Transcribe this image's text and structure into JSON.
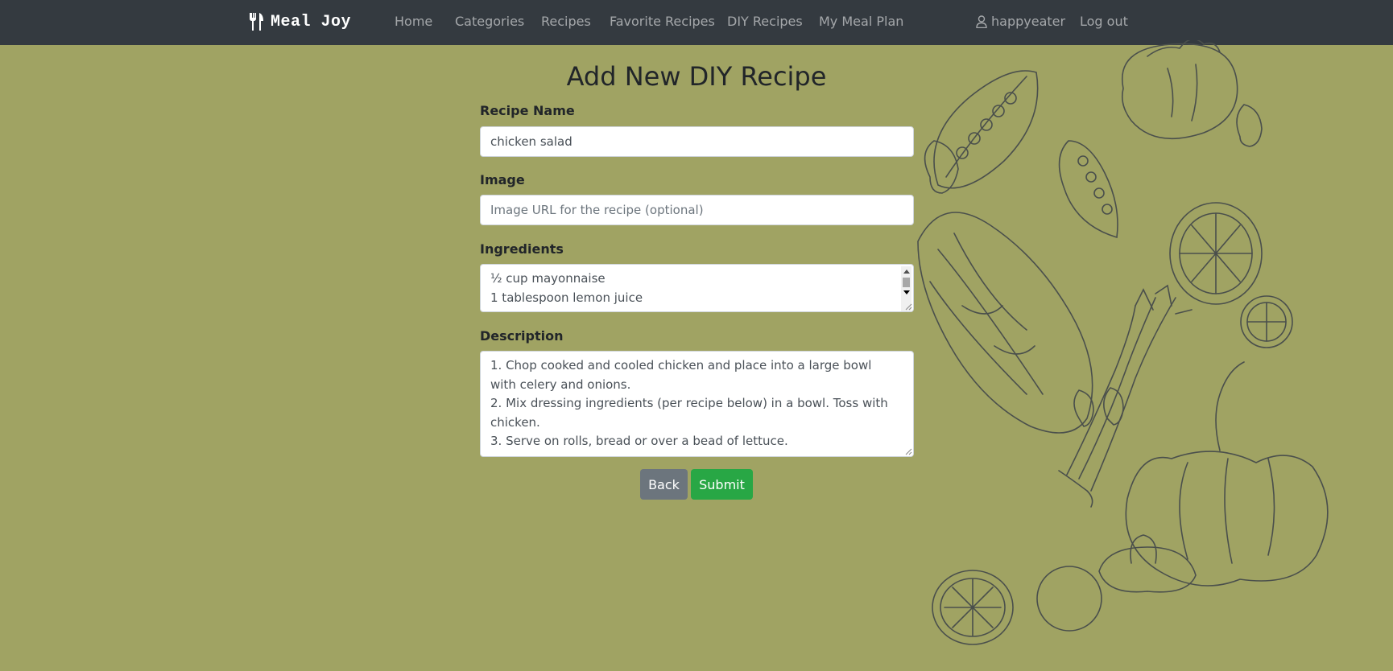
{
  "nav": {
    "brand": "Meal Joy",
    "brand_icon": "utensils-icon",
    "links": [
      {
        "label": "Home"
      },
      {
        "label": "Categories"
      },
      {
        "label": "Recipes"
      },
      {
        "label": "Favorite Recipes"
      },
      {
        "label": "DIY Recipes"
      },
      {
        "label": "My Meal Plan"
      }
    ],
    "user_icon": "user-icon",
    "username": "happyeater",
    "logout": "Log out"
  },
  "form": {
    "title": "Add New DIY Recipe",
    "recipe_name": {
      "label": "Recipe Name",
      "value": "chicken salad"
    },
    "image": {
      "label": "Image",
      "value": "",
      "placeholder": "Image URL for the recipe (optional)"
    },
    "ingredients": {
      "label": "Ingredients",
      "lines": [
        "½ cup mayonnaise",
        "1 tablespoon lemon juice"
      ]
    },
    "description": {
      "label": "Description",
      "lines": [
        "1. Chop cooked and cooled chicken and place into a large bowl with celery and onions.",
        "2. Mix dressing ingredients (per recipe below) in a bowl. Toss with chicken.",
        "3. Serve on rolls, bread or over a bead of lettuce."
      ]
    },
    "back_label": "Back",
    "submit_label": "Submit"
  },
  "colors": {
    "navbar": "#343a40",
    "background": "#a0a363",
    "back_button": "#6c757d",
    "submit_button": "#28a745"
  }
}
